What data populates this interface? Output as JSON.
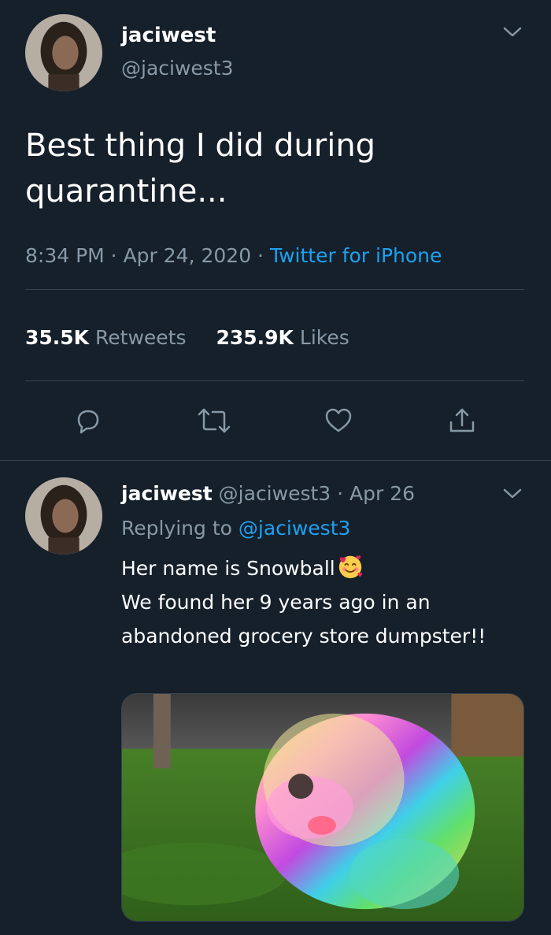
{
  "tweet": {
    "display_name": "jaciwest",
    "handle": "@jaciwest3",
    "text": "Best thing I did during quarantine...",
    "time": "8:34 PM · Apr 24, 2020 · ",
    "source": "Twitter for iPhone",
    "retweets_count": "35.5K",
    "retweets_label": "Retweets",
    "likes_count": "235.9K",
    "likes_label": "Likes"
  },
  "reply": {
    "display_name": "jaciwest",
    "handle_date": "@jaciwest3 · Apr 26",
    "replying_prefix": "Replying to ",
    "replying_to": "@jaciwest3",
    "line1": "Her name is Snowball",
    "line2": "We found her 9 years ago in an abandoned grocery store dumpster!!"
  },
  "icons": [
    "chevron-down-icon",
    "reply-icon",
    "retweet-icon",
    "like-icon",
    "share-icon",
    "smiling-face-with-hearts-emoji"
  ],
  "colors": {
    "background": "#15202b",
    "secondary_text": "#8899a6",
    "link": "#1da1f2",
    "divider": "#38444d"
  }
}
